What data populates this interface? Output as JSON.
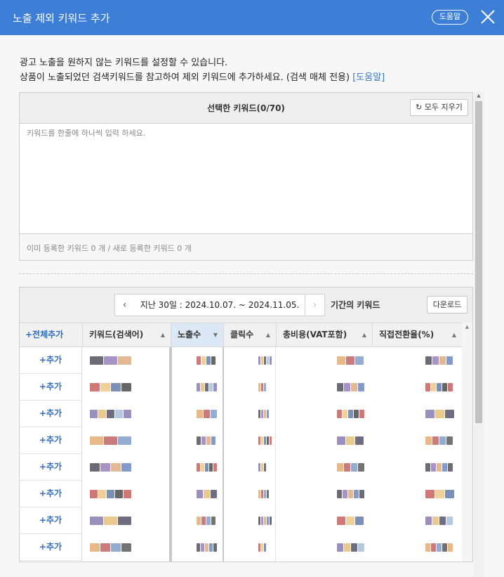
{
  "header": {
    "title": "노출 제외 키워드 추가",
    "help_label": "도움말"
  },
  "description": {
    "line1": "광고 노출을 원하지 않는 키워드를 설정할 수 있습니다.",
    "line2": "상품이 노출되었던 검색키워드를 참고하여 제외 키워드에 추가하세요. (검색 매체 전용)",
    "link": "[도움말]"
  },
  "keyword_box": {
    "title": "선택한 키워드(0/70)",
    "clear_label": "모두 지우기",
    "placeholder": "키워드를 한줄에 하나씩 입력 하세요.",
    "footer": "이미 등록한 키워드 0 개 / 새로 등록한 키워드 0 개"
  },
  "period": {
    "range": "지난 30일 : 2024.10.07. ~ 2024.11.05.",
    "suffix": "기간의 키워드",
    "download_label": "다운로드"
  },
  "table": {
    "add_all_label": "+전체추가",
    "columns": [
      "키워드(검색어)",
      "노출수",
      "클릭수",
      "총비용(VAT포함)",
      "직접전환율(%)"
    ],
    "sorted_column": "노출수",
    "row_add_label": "+추가",
    "row_count": 8
  },
  "colors": {
    "header_bg": "#3d7ed6",
    "accent": "#2f6cbf",
    "link": "#3a74c4"
  }
}
